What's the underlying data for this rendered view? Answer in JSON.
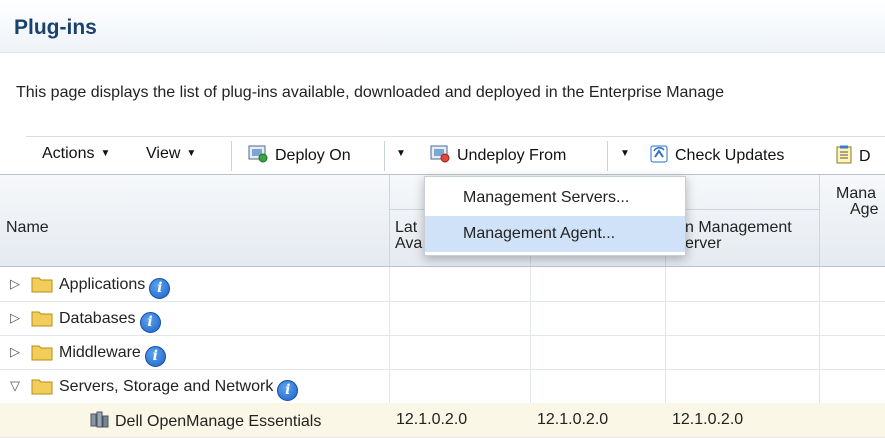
{
  "page": {
    "title": "Plug-ins",
    "description": "This page displays the list of plug-ins available, downloaded and deployed in the Enterprise Manage"
  },
  "toolbar": {
    "actions_label": "Actions",
    "view_label": "View",
    "deploy_on_label": "Deploy On",
    "undeploy_from_label": "Undeploy From",
    "check_updates_label": "Check Updates",
    "truncated_label": "D"
  },
  "menu": {
    "items": [
      {
        "label": "Management Servers...",
        "highlighted": false
      },
      {
        "label": "Management Agent...",
        "highlighted": true
      }
    ]
  },
  "table": {
    "headers": {
      "name": "Name",
      "latest_available_line1": "Lat",
      "latest_available_line2": "Ava",
      "on_mgmt_server_line1": "n Management",
      "on_mgmt_server_line2": "erver",
      "mgmt_agent_line1": "Mana",
      "mgmt_agent_line2": "Age"
    },
    "rows": [
      {
        "name": "Applications",
        "expanded": false
      },
      {
        "name": "Databases",
        "expanded": false
      },
      {
        "name": "Middleware",
        "expanded": false
      },
      {
        "name": "Servers, Storage and Network",
        "expanded": true
      },
      {
        "name": "Dell OpenManage Essentials",
        "col2": "12.1.0.2.0",
        "col3": "12.1.0.2.0",
        "col4": "12.1.0.2.0",
        "selected": true
      }
    ]
  },
  "colors": {
    "title": "#19436e",
    "selected_row": "#fbf7e6",
    "menu_highlight": "#cfe2f7"
  },
  "icons": [
    "caret-down-icon",
    "deploy-icon",
    "undeploy-icon",
    "check-updates-icon",
    "notes-icon",
    "folder-icon",
    "info-icon",
    "expand-triangle-icon",
    "collapse-triangle-icon",
    "plugin-icon"
  ]
}
